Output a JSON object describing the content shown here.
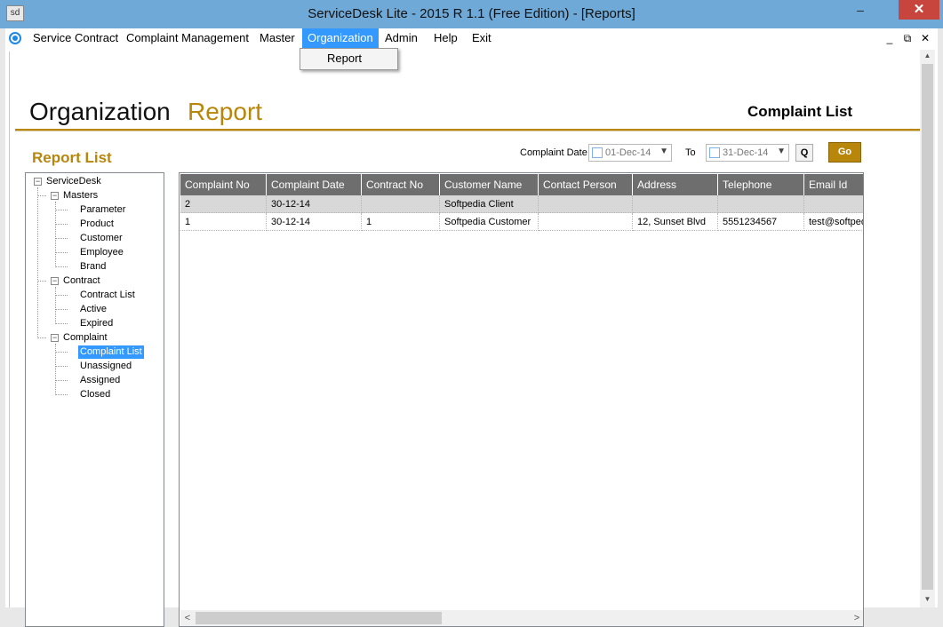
{
  "window": {
    "title": "ServiceDesk Lite - 2015 R 1.1 (Free Edition) - [Reports]",
    "app_icon_text": "sd",
    "minimize_symbol": "–",
    "close_symbol": "✕"
  },
  "menubar": {
    "items": [
      "Service Contract",
      "Complaint Management",
      "Master",
      "Organization",
      "Admin",
      "Help",
      "Exit"
    ],
    "active": "Organization",
    "mdi_controls": [
      "_",
      "⧉",
      "✕"
    ]
  },
  "dropdown": {
    "items": [
      "Report"
    ]
  },
  "page": {
    "title_part1": "Organization",
    "title_part2": "Report",
    "subtitle": "Complaint List",
    "report_list_title": "Report List"
  },
  "filters": {
    "date_label": "Complaint Date",
    "from_value": "01-Dec-14",
    "to_label": "To",
    "to_value": "31-Dec-14",
    "query_button": "Q",
    "go_button": "Go"
  },
  "tree": {
    "root": "ServiceDesk",
    "groups": [
      {
        "label": "Masters",
        "children": [
          "Parameter",
          "Product",
          "Customer",
          "Employee",
          "Brand"
        ]
      },
      {
        "label": "Contract",
        "children": [
          "Contract List",
          "Active",
          "Expired"
        ]
      },
      {
        "label": "Complaint",
        "children": [
          "Complaint List",
          "Unassigned",
          "Assigned",
          "Closed"
        ]
      }
    ],
    "selected": "Complaint List"
  },
  "grid": {
    "columns": [
      "Complaint No",
      "Complaint Date",
      "Contract No",
      "Customer Name",
      "Contact Person",
      "Address",
      "Telephone",
      "Email Id"
    ],
    "rows": [
      [
        "2",
        "30-12-14",
        "",
        "Softpedia Client",
        "",
        "",
        "",
        ""
      ],
      [
        "1",
        "30-12-14",
        "1",
        "Softpedia Customer",
        "",
        "12, Sunset Blvd",
        "5551234567",
        "test@softpedia.com"
      ]
    ]
  },
  "colors": {
    "titlebar": "#6ea9d7",
    "accent_gold": "#b8860b",
    "menu_highlight": "#3399ff",
    "grid_header": "#6e6e6e",
    "close_button": "#c7453c"
  }
}
